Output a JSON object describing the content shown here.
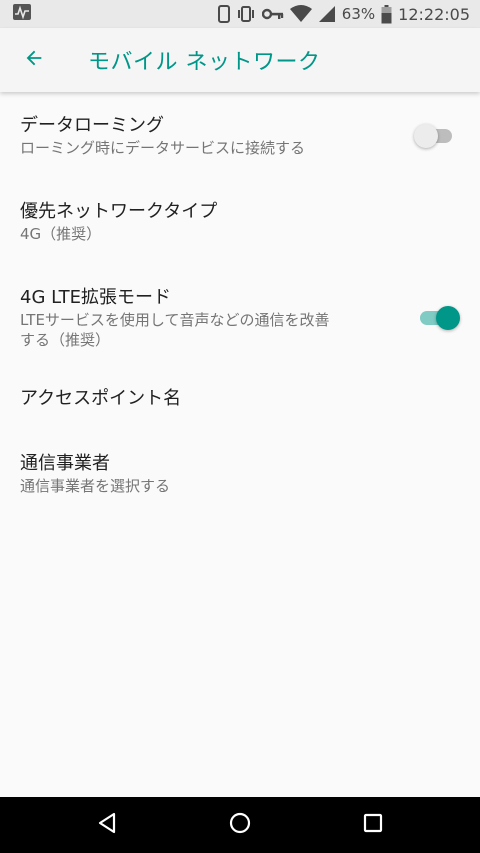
{
  "status_bar": {
    "battery_percent": "63%",
    "time": "12:22:05"
  },
  "app_bar": {
    "title": "モバイル ネットワーク"
  },
  "preferences": [
    {
      "title": "データローミング",
      "summary": "ローミング時にデータサービスに接続する",
      "toggle": "off"
    },
    {
      "title": "優先ネットワークタイプ",
      "summary": "4G（推奨）"
    },
    {
      "title": "4G LTE拡張モード",
      "summary": "LTEサービスを使用して音声などの通信を改善する（推奨）",
      "toggle": "on"
    },
    {
      "title": "アクセスポイント名"
    },
    {
      "title": "通信事業者",
      "summary": "通信事業者を選択する"
    }
  ],
  "colors": {
    "accent": "#009688",
    "accent_light": "#80cbc4",
    "status_bar_bg": "#e9e9e9",
    "background": "#fafafa"
  }
}
